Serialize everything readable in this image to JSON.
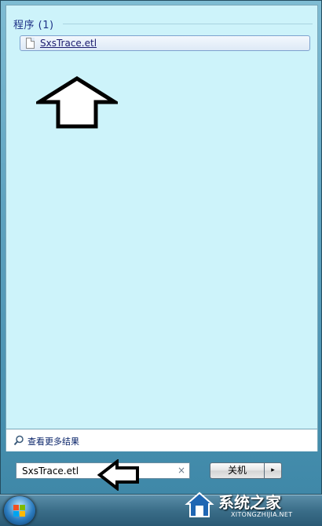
{
  "results": {
    "section_title": "程序 (1)",
    "items": [
      {
        "label": "SxsTrace.etl",
        "icon": "file-icon"
      }
    ]
  },
  "see_more": {
    "label": "查看更多结果",
    "icon": "search-icon"
  },
  "search": {
    "value": "SxsTrace.etl",
    "clear_glyph": "×"
  },
  "shutdown": {
    "label": "关机",
    "arrow_glyph": "▸"
  },
  "taskbar": {
    "start_icon": "windows-logo-icon"
  },
  "watermark": {
    "title": "系统之家",
    "subtitle": "XITONGZHIJIA.NET"
  },
  "colors": {
    "panel_bg": "#cdf3fa",
    "header_text": "#1e3287",
    "frame": "#5fa3c0"
  }
}
